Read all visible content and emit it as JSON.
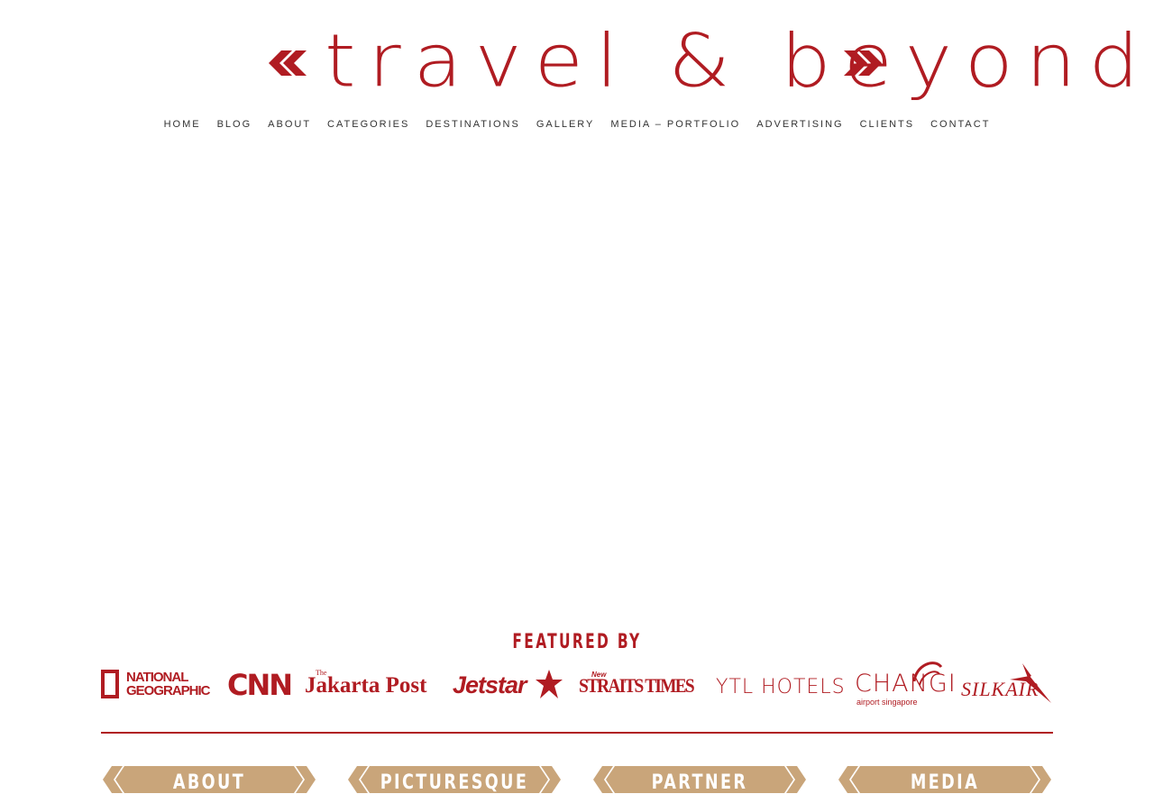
{
  "site": {
    "title": "travel & beyond",
    "accent_color": "#b01c22",
    "tab_color": "#c9a57a",
    "left_icon": "double-chevron-left-icon",
    "right_icon": "double-chevron-right-icon"
  },
  "nav": {
    "items": [
      {
        "label": "HOME"
      },
      {
        "label": "BLOG"
      },
      {
        "label": "ABOUT"
      },
      {
        "label": "CATEGORIES"
      },
      {
        "label": "DESTINATIONS"
      },
      {
        "label": "GALLERY"
      },
      {
        "label": "MEDIA – PORTFOLIO"
      },
      {
        "label": "ADVERTISING"
      },
      {
        "label": "CLIENTS"
      },
      {
        "label": "CONTACT"
      }
    ]
  },
  "featured": {
    "title": "FEATURED BY",
    "brands": [
      {
        "name": "NATIONAL GEOGRAPHIC",
        "line1": "NATIONAL",
        "line2": "GEOGRAPHIC"
      },
      {
        "name": "CNN"
      },
      {
        "name": "The Jakarta Post",
        "small": "The",
        "main": "Jakarta Post"
      },
      {
        "name": "Jetstar"
      },
      {
        "name": "New Straits Times",
        "small": "New",
        "main": "STRAITS TIMES"
      },
      {
        "name": "YTL HOTELS"
      },
      {
        "name": "CHANGI airport singapore",
        "main": "CHANGI",
        "sub": "airport singapore"
      },
      {
        "name": "SILKAIR"
      }
    ]
  },
  "tabs": [
    {
      "label": "ABOUT"
    },
    {
      "label": "PICTURESQUE"
    },
    {
      "label": "PARTNER"
    },
    {
      "label": "MEDIA"
    }
  ]
}
